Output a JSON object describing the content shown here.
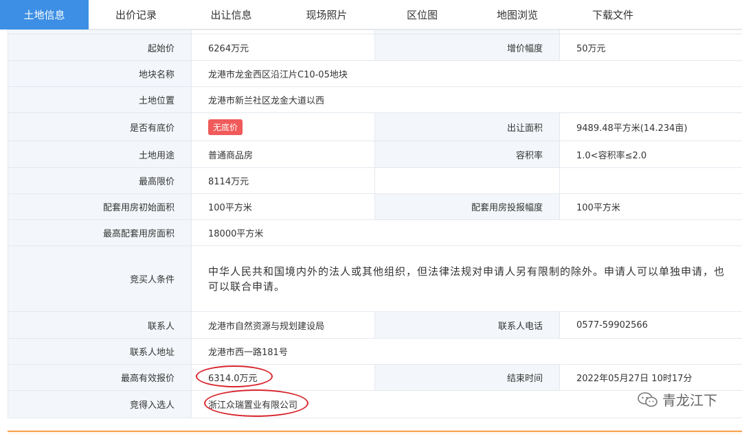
{
  "tabs": [
    {
      "label": "土地信息",
      "active": true
    },
    {
      "label": "出价记录"
    },
    {
      "label": "出让信息"
    },
    {
      "label": "现场照片"
    },
    {
      "label": "区位图"
    },
    {
      "label": "地图浏览"
    },
    {
      "label": "下载文件"
    }
  ],
  "rows": {
    "start_price": {
      "label": "起始价",
      "value": "6264万元"
    },
    "increment": {
      "label": "增价幅度",
      "value": "50万元"
    },
    "parcel_name": {
      "label": "地块名称",
      "value": "龙港市龙金西区沿江片C10-05地块"
    },
    "location": {
      "label": "土地位置",
      "value": "龙港市新兰社区龙金大道以西"
    },
    "reserve": {
      "label": "是否有底价",
      "value": "无底价"
    },
    "area": {
      "label": "出让面积",
      "value": "9489.48平方米(14.234亩)"
    },
    "usage": {
      "label": "土地用途",
      "value": "普通商品房"
    },
    "far": {
      "label": "容积率",
      "value": "1.0<容积率≤2.0"
    },
    "max_price": {
      "label": "最高限价",
      "value": "8114万元"
    },
    "housing_init": {
      "label": "配套用房初始面积",
      "value": "100平方米"
    },
    "housing_step": {
      "label": "配套用房投报幅度",
      "value": "100平方米"
    },
    "housing_max": {
      "label": "最高配套用房面积",
      "value": "18000平方米"
    },
    "bidder_cond": {
      "label": "竞买人条件",
      "value": "中华人民共和国境内外的法人或其他组织，但法律法规对申请人另有限制的除外。申请人可以单独申请，也可以联合申请。"
    },
    "contact": {
      "label": "联系人",
      "value": "龙港市自然资源与规划建设局"
    },
    "phone": {
      "label": "联系人电话",
      "value": "0577-59902566"
    },
    "address": {
      "label": "联系人地址",
      "value": "龙港市西一路181号"
    },
    "highest_bid": {
      "label": "最高有效报价",
      "value": "6314.0万元"
    },
    "end_time": {
      "label": "结束时间",
      "value": "2022年05月27日 10时17分"
    },
    "winner": {
      "label": "竞得入选人",
      "value": "浙江众瑞置业有限公司"
    }
  },
  "watermark": {
    "text": "青龙江下",
    "icon": "wechat-icon"
  },
  "colors": {
    "accent": "#3c8fe4",
    "badge": "#f05a5a",
    "annotation": "#d8242c"
  }
}
